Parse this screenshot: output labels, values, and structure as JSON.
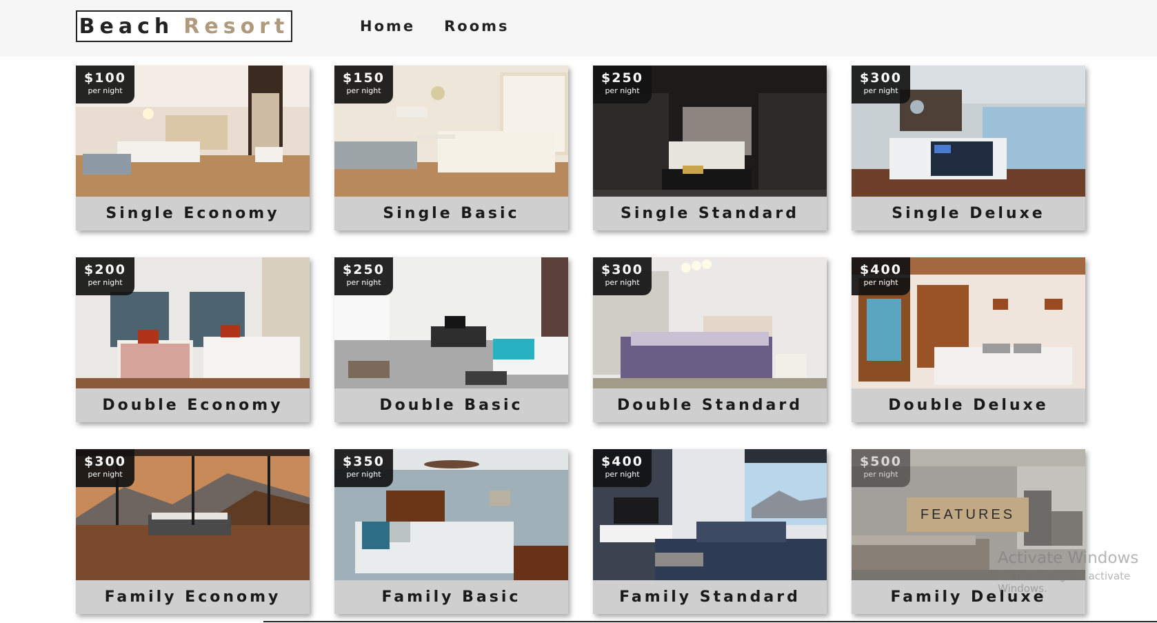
{
  "header": {
    "logo_part1": "Beach",
    "logo_part2": "Resort",
    "nav": [
      "Home",
      "Rooms"
    ]
  },
  "colors": {
    "accent": "#b09a7e",
    "features_button": "#c1a985",
    "name_bar": "#cfcfcf",
    "badge": "#121212"
  },
  "rooms": [
    {
      "name": "Single Economy",
      "price": "$100",
      "per": "per night",
      "scene": "modern-bedroom-mirror"
    },
    {
      "name": "Single Basic",
      "price": "$150",
      "per": "per night",
      "scene": "bright-bedroom-desk"
    },
    {
      "name": "Single Standard",
      "price": "$250",
      "per": "per night",
      "scene": "dark-suite"
    },
    {
      "name": "Single Deluxe",
      "price": "$300",
      "per": "per night",
      "scene": "resort-bedroom"
    },
    {
      "name": "Double Economy",
      "price": "$200",
      "per": "per night",
      "scene": "twin-beds"
    },
    {
      "name": "Double Basic",
      "price": "$250",
      "per": "per night",
      "scene": "open-studio"
    },
    {
      "name": "Double Standard",
      "price": "$300",
      "per": "per night",
      "scene": "purple-bed"
    },
    {
      "name": "Double Deluxe",
      "price": "$400",
      "per": "per night",
      "scene": "wood-shutters"
    },
    {
      "name": "Family Economy",
      "price": "$300",
      "per": "per night",
      "scene": "mountain-view"
    },
    {
      "name": "Family Basic",
      "price": "$350",
      "per": "per night",
      "scene": "ceiling-fan-bedroom"
    },
    {
      "name": "Family Standard",
      "price": "$400",
      "per": "per night",
      "scene": "living-room-sea"
    },
    {
      "name": "Family Deluxe",
      "price": "$500",
      "per": "per night",
      "scene": "deluxe-room-hover",
      "hover_button": "FEATURES"
    }
  ],
  "watermark": {
    "line1": "Activate Windows",
    "line2": "Go to Settings to activate Windows."
  }
}
